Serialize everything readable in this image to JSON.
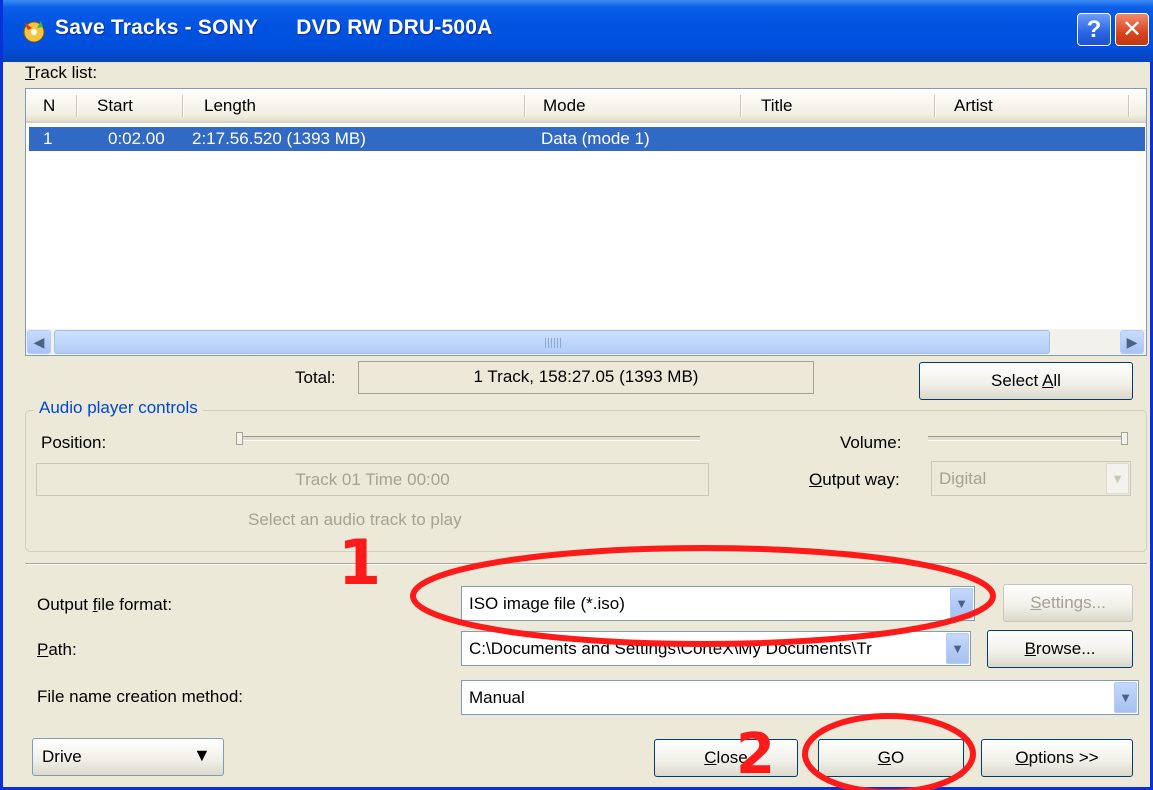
{
  "window": {
    "title": "Save Tracks - SONY",
    "title_device": "DVD RW DRU-500A",
    "help_glyph": "?",
    "close_glyph": "✕"
  },
  "track_list": {
    "label": "Track list:",
    "columns": [
      "N",
      "Start",
      "Length",
      "Mode",
      "Title",
      "Artist"
    ],
    "rows": [
      {
        "n": "1",
        "start": "0:02.00",
        "length": "2:17.56.520 (1393 MB)",
        "mode": "Data (mode 1)",
        "title": "",
        "artist": ""
      }
    ]
  },
  "total": {
    "label": "Total:",
    "value": "1 Track,  158:27.05 (1393 MB)"
  },
  "select_all_label": "Select All",
  "audio": {
    "group_title": "Audio player controls",
    "position_label": "Position:",
    "volume_label": "Volume:",
    "track_time": "Track 01 Time 00:00",
    "output_way_label": "Output way:",
    "output_way_value": "Digital",
    "hint": "Select an audio track to play"
  },
  "output": {
    "format_label": "Output file format:",
    "format_value": "ISO image file (*.iso)",
    "settings_label": "Settings...",
    "path_label": "Path:",
    "path_value": "C:\\Documents and Settings\\CorteX\\My Documents\\Tr",
    "browse_label": "Browse...",
    "method_label": "File name creation method:",
    "method_value": "Manual"
  },
  "footer": {
    "drive_label": "Drive",
    "close_label": "Close",
    "go_label": "GO",
    "options_label": "Options >>"
  },
  "annotations": {
    "mark_1": "1",
    "mark_2": "2",
    "color": "#ff1a1a"
  },
  "colors": {
    "titlebar": "#0053e0",
    "selection": "#316ac5",
    "dialog_bg": "#ece9d8"
  }
}
